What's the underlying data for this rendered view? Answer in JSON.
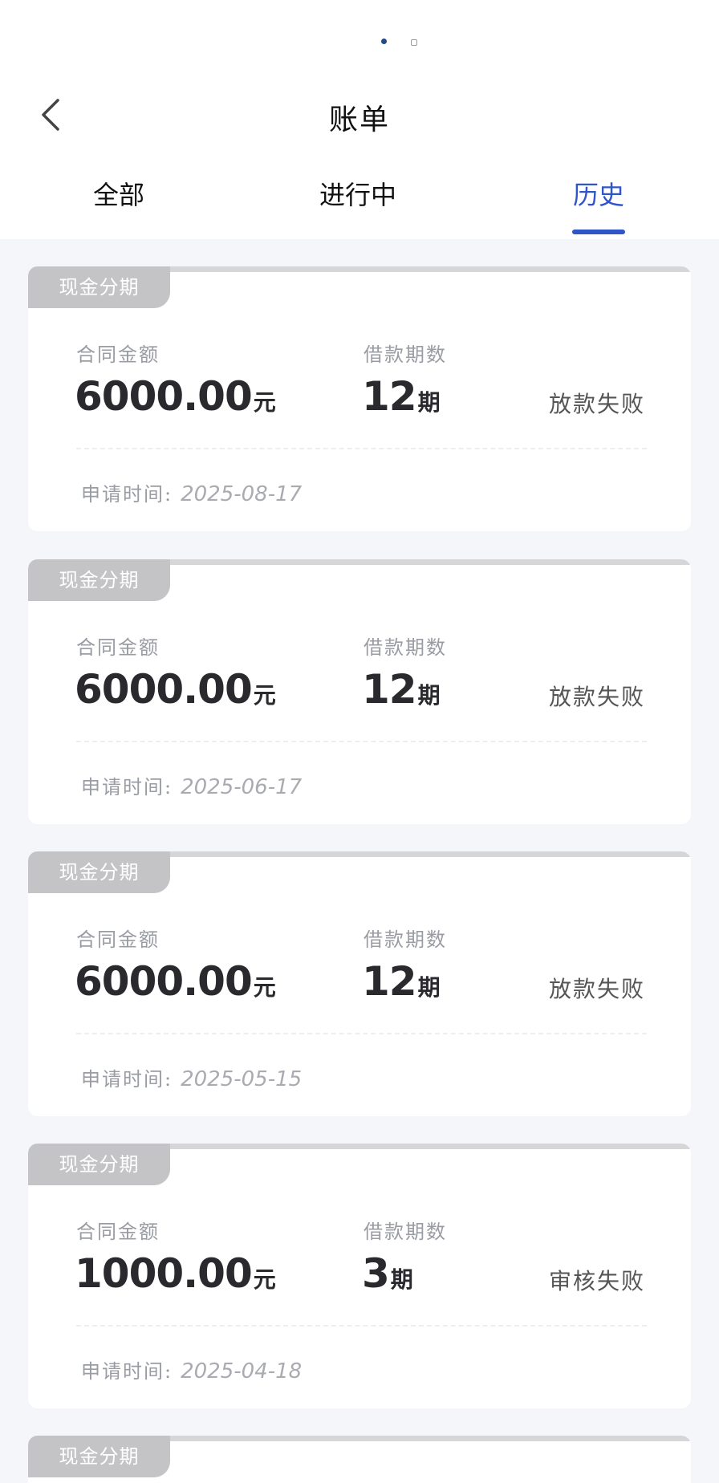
{
  "header": {
    "title": "账单",
    "back_icon": "chevron-left-icon"
  },
  "tabs": [
    {
      "label": "全部",
      "active": false
    },
    {
      "label": "进行中",
      "active": false
    },
    {
      "label": "历史",
      "active": true
    }
  ],
  "colors": {
    "accent": "#2f55c9",
    "tag_bg": "#c4c4c7",
    "page_bg": "#f5f6fa"
  },
  "labels": {
    "amount": "合同金额",
    "periods": "借款期数",
    "apply_time": "申请时间:",
    "amount_unit": "元",
    "period_unit": "期"
  },
  "bills": [
    {
      "tag": "现金分期",
      "amount": "6000.00",
      "periods": "12",
      "status": "放款失败",
      "date": "2025-08-17"
    },
    {
      "tag": "现金分期",
      "amount": "6000.00",
      "periods": "12",
      "status": "放款失败",
      "date": "2025-06-17"
    },
    {
      "tag": "现金分期",
      "amount": "6000.00",
      "periods": "12",
      "status": "放款失败",
      "date": "2025-05-15"
    },
    {
      "tag": "现金分期",
      "amount": "1000.00",
      "periods": "3",
      "status": "审核失败",
      "date": "2025-04-18"
    },
    {
      "tag": "现金分期"
    }
  ]
}
